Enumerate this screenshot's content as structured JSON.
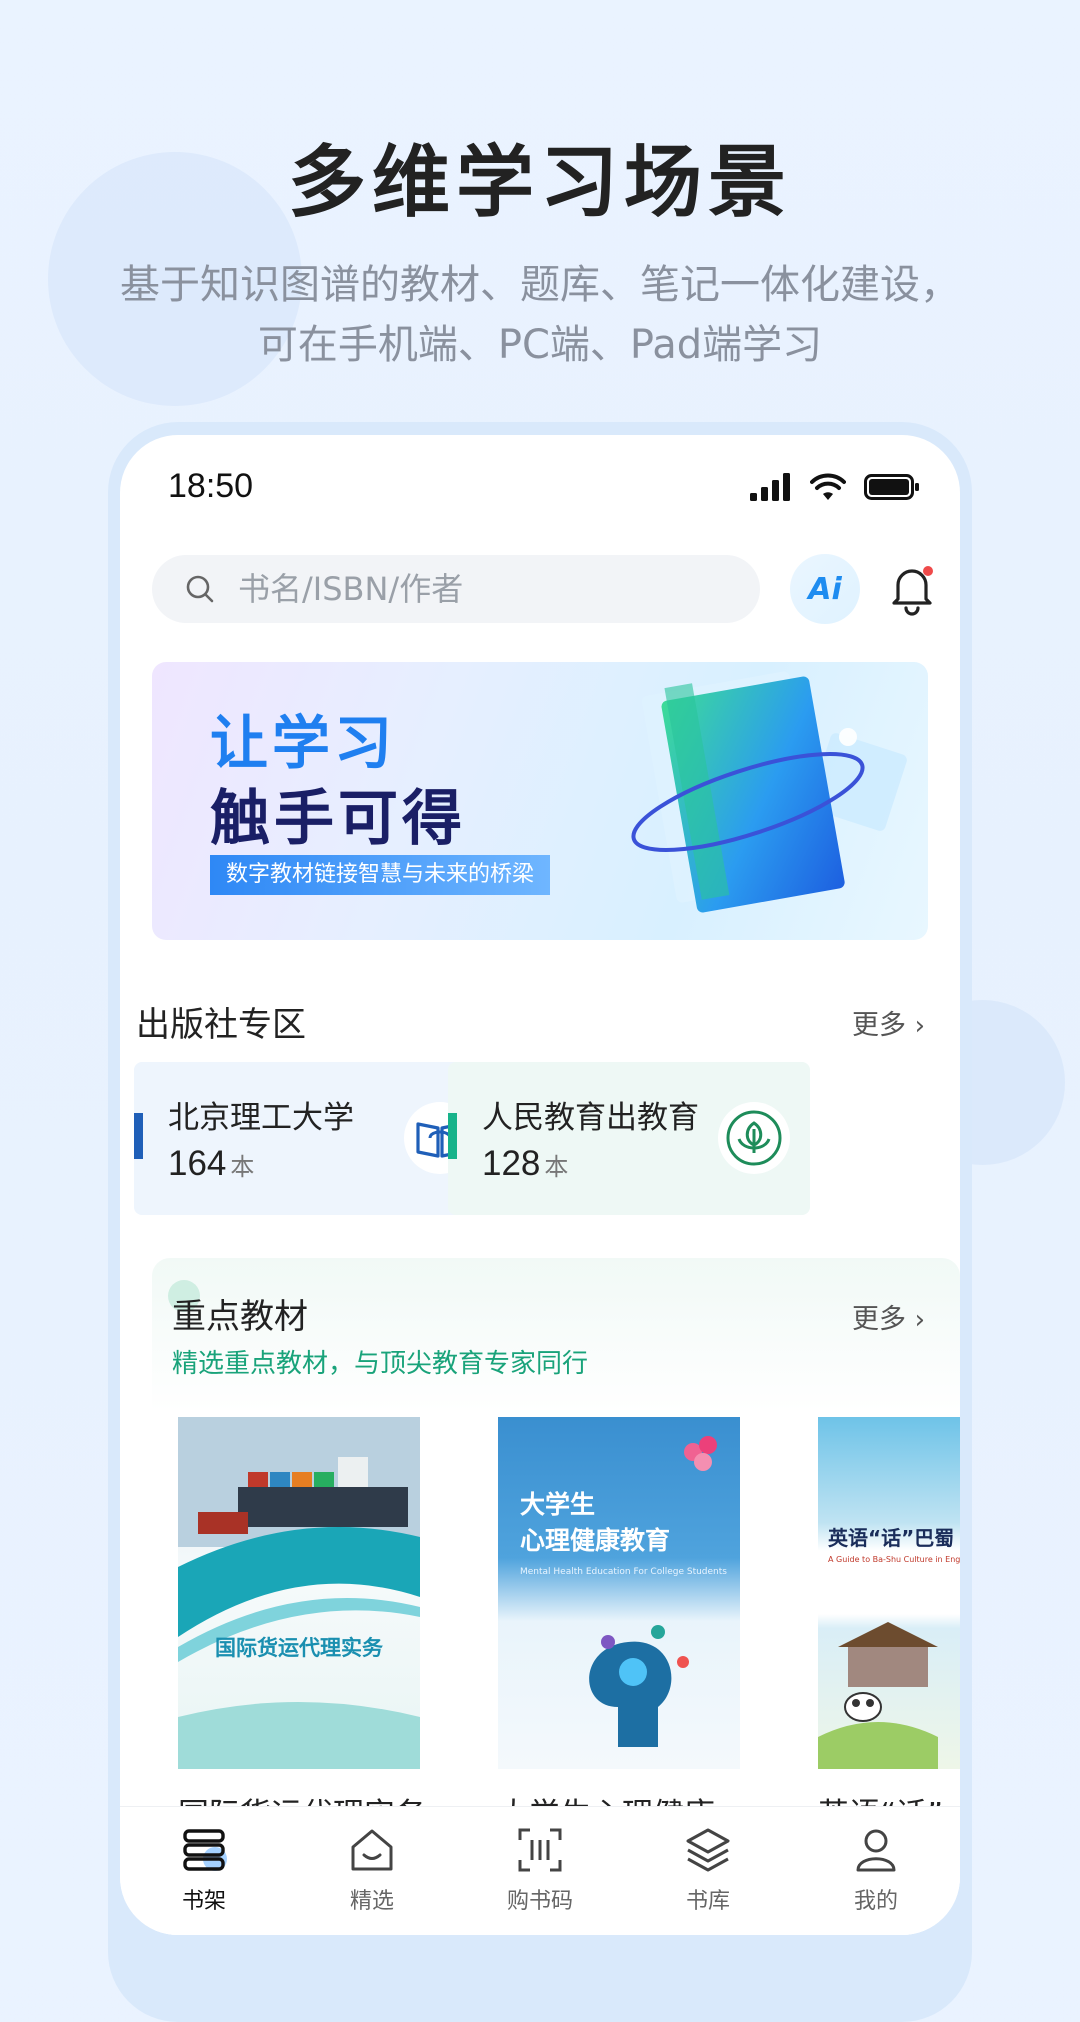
{
  "promo": {
    "title": "多维学习场景",
    "subtitle_line1": "基于知识图谱的教材、题库、笔记一体化建设，",
    "subtitle_line2": "可在手机端、PC端、Pad端学习"
  },
  "status_bar": {
    "time": "18:50"
  },
  "search": {
    "placeholder": "书名/ISBN/作者",
    "ai_label": "Ai"
  },
  "banner": {
    "line1": "让学习",
    "line2": "触手可得",
    "tagline": "数字教材链接智慧与未来的桥梁"
  },
  "publishers": {
    "title": "出版社专区",
    "more": "更多",
    "items": [
      {
        "name": "北京理工大学",
        "count": "164",
        "unit": "本",
        "accent": "#1f5fb8"
      },
      {
        "name": "人民教育出教育",
        "count": "128",
        "unit": "本",
        "accent": "#17b38a"
      }
    ]
  },
  "featured": {
    "title": "重点教材",
    "more": "更多",
    "description": "精选重点教材，与顶尖教育专家同行",
    "books": [
      {
        "title": "国际货运代理实务",
        "cover_title": "国际货运代理实务"
      },
      {
        "title": "大学生心理健康...",
        "cover_title_1": "大学生",
        "cover_title_2": "心理健康教育",
        "cover_subtitle": "Mental Health Education For College Students"
      },
      {
        "title": "英语“话”",
        "cover_title": "英语“话”巴蜀",
        "cover_subtitle": "A Guide to Ba-Shu Culture in English"
      }
    ]
  },
  "tabs": [
    {
      "label": "书架",
      "icon": "bookshelf-icon",
      "active": true
    },
    {
      "label": "精选",
      "icon": "smile-bag-icon",
      "active": false
    },
    {
      "label": "购书码",
      "icon": "scan-code-icon",
      "active": false
    },
    {
      "label": "书库",
      "icon": "layers-icon",
      "active": false
    },
    {
      "label": "我的",
      "icon": "user-icon",
      "active": false
    }
  ],
  "colors": {
    "accent": "#1f7ff0",
    "green": "#19a37a",
    "navy": "#1a1f66"
  }
}
